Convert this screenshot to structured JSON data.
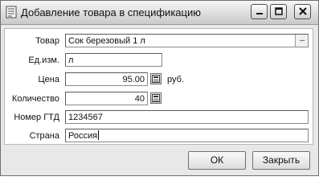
{
  "window": {
    "title": "Добавление товара в спецификацию"
  },
  "form": {
    "product": {
      "label": "Товар",
      "value": "Сок березовый 1 л",
      "button": "..."
    },
    "unit": {
      "label": "Ед.изм.",
      "value": "л"
    },
    "price": {
      "label": "Цена",
      "value": "95.00",
      "suffix": "руб."
    },
    "quantity": {
      "label": "Количество",
      "value": "40"
    },
    "gtd": {
      "label": "Номер ГТД",
      "value": "1234567"
    },
    "country": {
      "label": "Страна",
      "value": "Россия"
    }
  },
  "buttons": {
    "ok": "ОК",
    "close": "Закрыть"
  },
  "icons": {
    "app": "form-icon",
    "minimize": "minimize-icon",
    "maximize": "maximize-icon",
    "close": "close-icon",
    "calculator": "calculator-icon"
  }
}
